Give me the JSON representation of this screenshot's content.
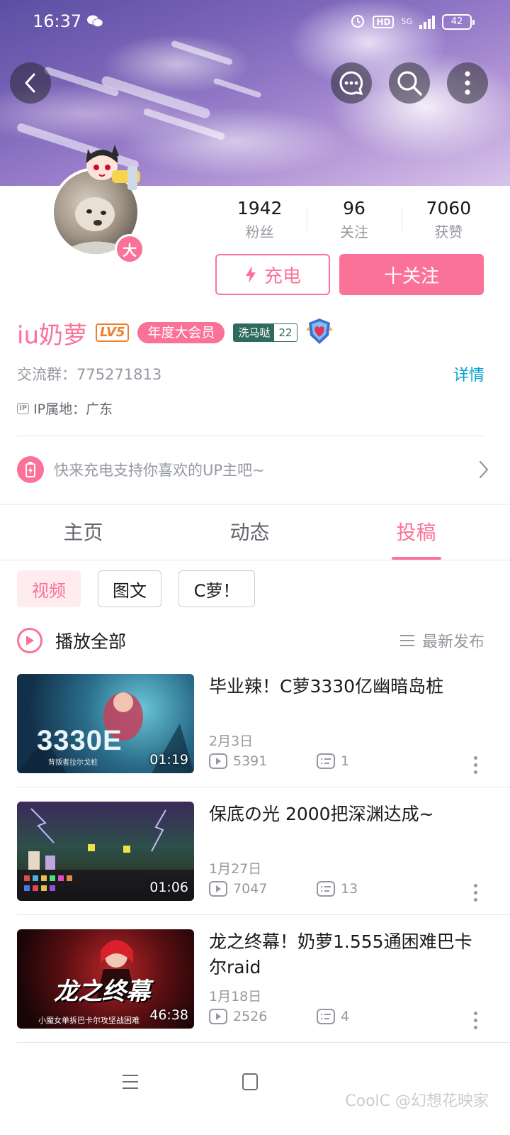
{
  "status_bar": {
    "time": "16:37",
    "network": "5G",
    "hd": "HD",
    "battery": "42"
  },
  "profile": {
    "vip_badge_char": "大",
    "stats": [
      {
        "value": "1942",
        "label": "粉丝"
      },
      {
        "value": "96",
        "label": "关注"
      },
      {
        "value": "7060",
        "label": "获赞"
      }
    ],
    "charge_label": "充电",
    "follow_label": "十关注",
    "username": "iu奶萝",
    "level": "LV5",
    "vip_label": "年度大会员",
    "medal_name": "洗马哒",
    "medal_level": "22",
    "group_text": "交流群：775271813",
    "detail_link": "详情",
    "ip_icon": "IP",
    "ip_text": "IP属地：广东",
    "charge_prompt": "快来充电支持你喜欢的UP主吧~"
  },
  "tabs": [
    {
      "label": "主页",
      "active": false
    },
    {
      "label": "动态",
      "active": false
    },
    {
      "label": "投稿",
      "active": true
    }
  ],
  "chips": [
    {
      "label": "视频",
      "active": true
    },
    {
      "label": "图文",
      "active": false
    },
    {
      "label": "C萝！",
      "active": false
    }
  ],
  "play_all": "播放全部",
  "sort_label": "最新发布",
  "videos": [
    {
      "title": "毕业辣！C萝3330亿幽暗岛桩",
      "date": "2月3日",
      "views": "5391",
      "comments": "1",
      "duration": "01:19",
      "thumb_text": "3330E",
      "thumb_sub": "背叛者拉尔戈桩"
    },
    {
      "title": "保底の光  2000把深渊达成~",
      "date": "1月27日",
      "views": "7047",
      "comments": "13",
      "duration": "01:06",
      "thumb_text": "",
      "thumb_sub": ""
    },
    {
      "title": "龙之终幕！奶萝1.555通困难巴卡尔raid",
      "date": "1月18日",
      "views": "2526",
      "comments": "4",
      "duration": "46:38",
      "thumb_text": "龙之终幕",
      "thumb_sub": "小魔女单拆巴卡尔攻坚战困难"
    }
  ],
  "watermark": "CoolC @幻想花映家",
  "colors": {
    "accent": "#fb7299",
    "link": "#00a1d6",
    "text_secondary": "#9499a0"
  }
}
